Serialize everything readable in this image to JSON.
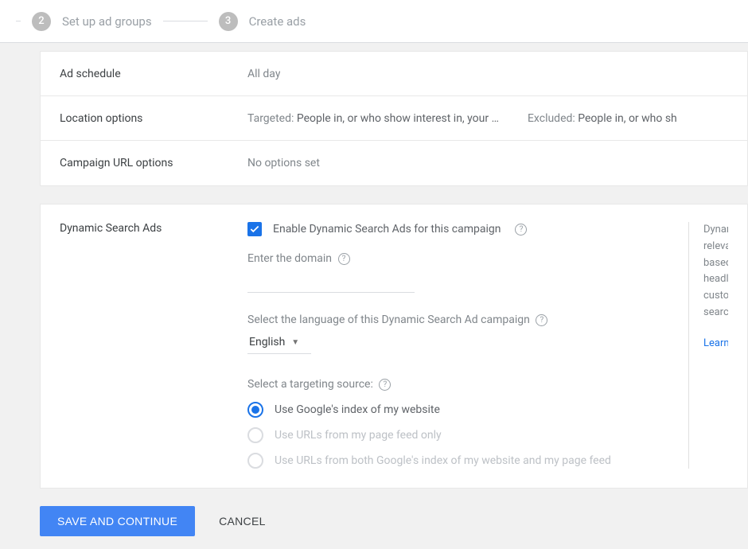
{
  "stepper": {
    "steps": [
      {
        "num": "2",
        "label": "Set up ad groups"
      },
      {
        "num": "3",
        "label": "Create ads"
      }
    ]
  },
  "settings": {
    "ad_schedule_label": "Ad schedule",
    "ad_schedule_value": "All day",
    "location_options_label": "Location options",
    "location_targeted_prefix": "Targeted: ",
    "location_targeted_value": "People in, or who show interest in, your …",
    "location_excluded_prefix": "Excluded: ",
    "location_excluded_value": "People in, or who sh",
    "url_options_label": "Campaign URL options",
    "url_options_value": "No options set"
  },
  "dsa": {
    "section_label": "Dynamic Search Ads",
    "enable_label": "Enable Dynamic Search Ads for this campaign",
    "domain_label": "Enter the domain",
    "domain_value": "",
    "language_label": "Select the language of this Dynamic Search Ad campaign",
    "language_value": "English",
    "targeting_label": "Select a targeting source:",
    "targeting_options": [
      "Use Google's index of my website",
      "Use URLs from my page feed only",
      "Use URLs from both Google's index of my website and my page feed"
    ],
    "help_text": "Dynamic Search Ads target relevant searches automatically based on your website, then use headlines automatically customized to people's actual searches.",
    "help_lines": [
      "Dynar",
      "releva",
      "based",
      "headl",
      "custo",
      "searc"
    ],
    "learn_label": "Learn"
  },
  "footer": {
    "save_label": "SAVE AND CONTINUE",
    "cancel_label": "CANCEL"
  }
}
